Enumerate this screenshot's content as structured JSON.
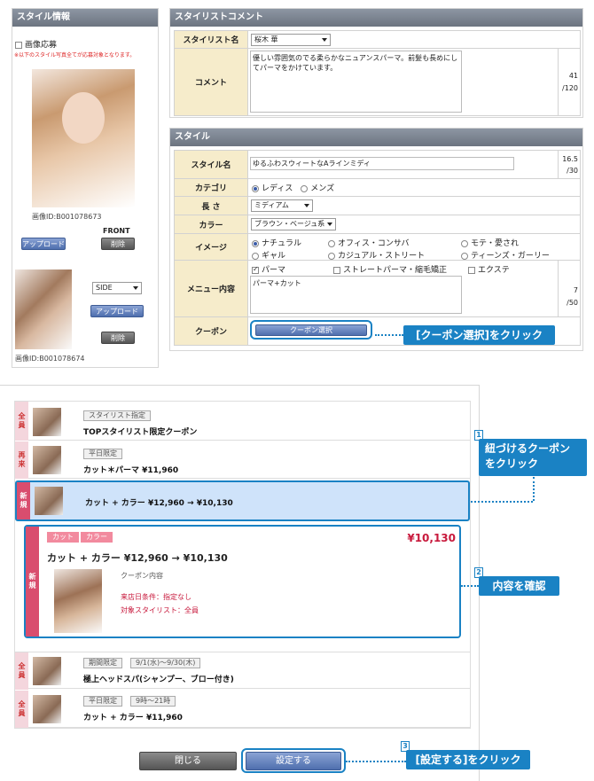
{
  "style_info": {
    "header": "スタイル情報",
    "photo_apply_label": "画像応募",
    "note": "※以下のスタイル写真全てが応募対象となります。",
    "front": {
      "label": "FRONT",
      "image_id": "画像ID:B001078673",
      "upload": "アップロード",
      "delete": "削除"
    },
    "side": {
      "select_value": "SIDE",
      "image_id": "画像ID:B001078674",
      "upload": "アップロード",
      "delete": "削除"
    }
  },
  "stylist_comment": {
    "header": "スタイリストコメント",
    "stylist_label": "スタイリスト名",
    "stylist_value": "桜木 華",
    "comment_label": "コメント",
    "comment_value": "優しい雰囲気のでる柔らかなニュアンスパーマ。前髪も長めにしてパーマをかけています。",
    "count": "41",
    "max": "/120"
  },
  "style": {
    "header": "スタイル",
    "name_label": "スタイル名",
    "name_value": "ゆるふわスウィートなAラインミディ",
    "name_count": "16.5",
    "name_max": "/30",
    "category_label": "カテゴリ",
    "category_options": [
      "レディス",
      "メンズ"
    ],
    "length_label": "長 さ",
    "length_value": "ミディアム",
    "color_label": "カラー",
    "color_value": "ブラウン・ベージュ系",
    "image_label": "イメージ",
    "image_options": [
      "ナチュラル",
      "オフィス・コンサバ",
      "モテ・愛され",
      "ギャル",
      "カジュアル・ストリート",
      "ティーンズ・ガーリー"
    ],
    "menu_label": "メニュー内容",
    "menu_options": [
      "パーマ",
      "ストレートパーマ・縮毛矯正",
      "エクステ"
    ],
    "menu_text": "パーマ+カット",
    "menu_count": "7",
    "menu_max": "/50",
    "coupon_label": "クーポン",
    "coupon_button": "クーポン選択",
    "coupon_callout": "[クーポン選択]をクリック"
  },
  "coupons": [
    {
      "side": "全員",
      "tags": [
        "スタイリスト指定"
      ],
      "title": "TOPスタイリスト限定クーポン"
    },
    {
      "side": "再来",
      "tags": [
        "平日限定"
      ],
      "title": "カット＊パーマ ¥11,960"
    },
    {
      "side": "新規",
      "tags": [],
      "title": "カット + カラー ¥12,960 → ¥10,130"
    },
    {
      "side": "全員",
      "tags": [
        "期間限定",
        "9/1(水)〜9/30(木)"
      ],
      "title": "極上ヘッドスパ(シャンプー、ブロー付き)"
    },
    {
      "side": "全員",
      "tags": [
        "平日限定",
        "9時〜21時"
      ],
      "title": "カット + カラー ¥11,960"
    }
  ],
  "detail": {
    "side": "新規",
    "tags": [
      "カット",
      "カラー"
    ],
    "price": "¥10,130",
    "title": "カット + カラー ¥12,960 → ¥10,130",
    "content_label": "クーポン内容",
    "condition": "来店日条件：指定なし",
    "stylist": "対象スタイリスト：全員"
  },
  "callouts": {
    "c1_num": "1",
    "c1_text1": "紐づけるクーポン",
    "c1_text2": "をクリック",
    "c2_num": "2",
    "c2_text": "内容を確認",
    "c3_num": "3",
    "c3_text": "[設定する]をクリック"
  },
  "footer": {
    "close": "閉じる",
    "set": "設定する"
  },
  "colors": {
    "accent": "#1a82c4",
    "price": "#c8193c",
    "selected_row": "#cfe3fa"
  }
}
